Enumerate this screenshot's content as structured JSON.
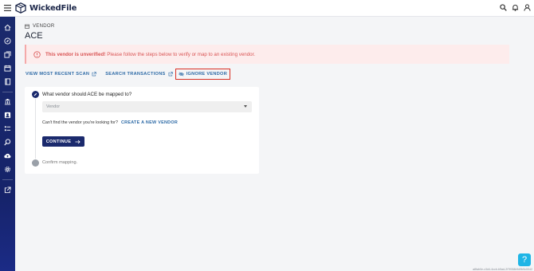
{
  "app": {
    "name": "WickedFile"
  },
  "breadcrumb": {
    "label": "VENDOR"
  },
  "page": {
    "title": "ACE"
  },
  "alert": {
    "strong": "This vendor is unverified!",
    "message": "Please follow the steps below to verify or map to an existing vendor."
  },
  "actions": {
    "view_scan": "VIEW MOST RECENT SCAN",
    "search_transactions": "SEARCH TRANSACTIONS",
    "ignore_vendor": "IGNORE VENDOR"
  },
  "step1": {
    "question": "What vendor should ACE be mapped to?",
    "select_placeholder": "Vendor",
    "cant_find": "Can't find the vendor you're looking for?",
    "create_link": "CREATE A NEW VENDOR",
    "continue_label": "CONTINUE"
  },
  "step2": {
    "label": "Confirm mapping."
  },
  "help": {
    "label": "?"
  },
  "footer": {
    "build_id": "a8fab0e-c3d4-4ccb-b5ad-2f7f058b9d9b9c0042"
  },
  "colors": {
    "primary": "#1b2a6d",
    "link": "#2d6aa6",
    "alert_bg": "#fdecec",
    "alert_text": "#d95454",
    "help": "#1fb5e6",
    "highlight": "#d93025"
  },
  "icons": {
    "sidebar": [
      "home-icon",
      "compass-icon",
      "documents-icon",
      "calendar-icon",
      "book-icon",
      "bank-icon",
      "contact-icon",
      "list-icon",
      "search-icon",
      "cloud-upload-icon",
      "settings-icon",
      "external-link-icon"
    ]
  }
}
